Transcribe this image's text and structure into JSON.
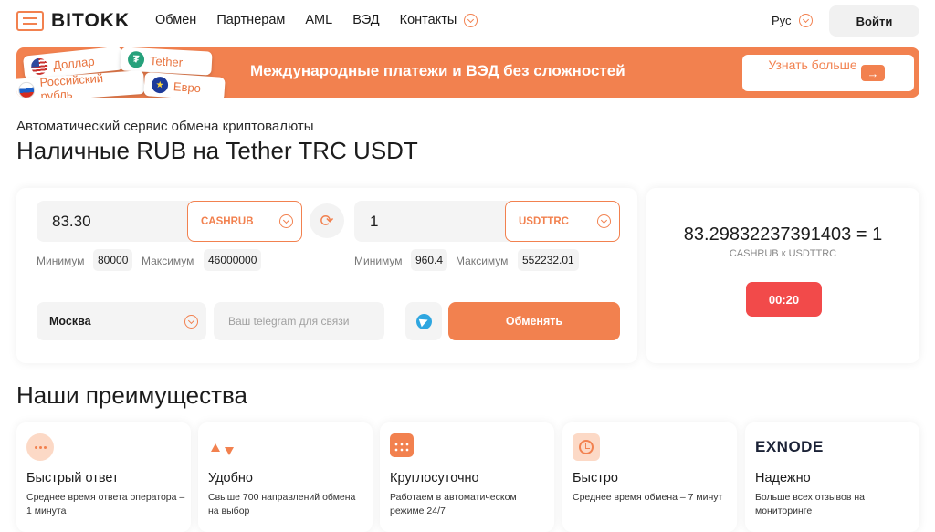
{
  "header": {
    "logo": "BITOKK",
    "nav": [
      "Обмен",
      "Партнерам",
      "AML",
      "ВЭД",
      "Контакты"
    ],
    "lang": "Рус",
    "login": "Войти"
  },
  "banner": {
    "currencies": {
      "usd": "Доллар",
      "usdt": "Tether",
      "rub": "Российский рубль",
      "eur": "Евро"
    },
    "text": "Международные платежи и ВЭД без сложностей",
    "button": "Узнать больше",
    "accent": "#f2814f"
  },
  "page": {
    "subtitle": "Автоматический сервис обмена криптовалюты",
    "title": "Наличные RUB на Tether TRC USDT"
  },
  "exchange": {
    "give": {
      "amount": "83.30",
      "currency": "CASHRUB",
      "min_label": "Минимум",
      "min": "80000",
      "max_label": "Максимум",
      "max": "46000000"
    },
    "get": {
      "amount": "1",
      "currency": "USDTTRC",
      "min_label": "Минимум",
      "min": "960.4",
      "max_label": "Максимум",
      "max": "552232.01"
    },
    "city": "Москва",
    "telegram_placeholder": "Ваш telegram для связи",
    "submit": "Обменять"
  },
  "rate": {
    "value": "83.29832237391403 = 1",
    "pair": "CASHRUB к USDTTRC",
    "timer": "00:20",
    "timer_color": "#f24a4a"
  },
  "advantages": {
    "title": "Наши преимущества",
    "items": [
      {
        "icon": "chat-icon",
        "name": "Быстрый ответ",
        "desc": "Среднее время ответа оператора – 1 минута"
      },
      {
        "icon": "arrows-icon",
        "name": "Удобно",
        "desc": "Свыше 700 направлений обмена на выбор"
      },
      {
        "icon": "calendar-icon",
        "name": "Круглосуточно",
        "desc": "Работаем в автоматическом режиме 24/7"
      },
      {
        "icon": "clock-icon",
        "name": "Быстро",
        "desc": "Среднее время обмена – 7 минут"
      },
      {
        "icon": "exnode-logo",
        "logo": "EXNODE",
        "name": "Надежно",
        "desc": "Больше всех отзывов на мониторинге"
      }
    ]
  }
}
